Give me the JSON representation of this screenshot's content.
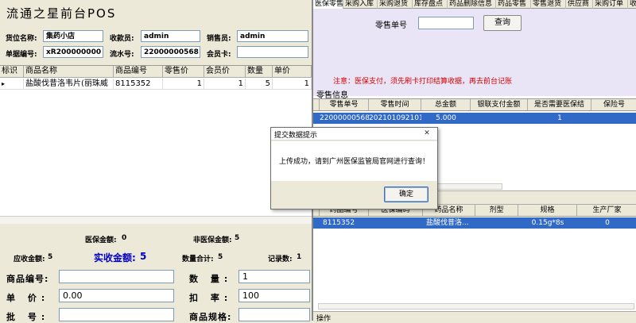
{
  "left": {
    "title": "流通之星前台POS",
    "fields": {
      "unit_label": "货位名称:",
      "unit_value": "集药小店",
      "cashier_label": "收款员:",
      "cashier_value": "admin",
      "sales_label": "销售员:",
      "sales_value": "admin",
      "doc_label": "单据编号:",
      "doc_value": "xR200000000",
      "serial_label": "流水号:",
      "serial_value": "22000000568",
      "member_label": "会员卡:",
      "member_value": ""
    },
    "grid": {
      "headers": [
        "标识",
        "商品名称",
        "商品编号",
        "零售价",
        "会员价",
        "数量",
        "单价"
      ],
      "row": {
        "marker": "▸",
        "name": "盐酸伐昔洛韦片(丽珠威",
        "code": "8115352",
        "retail": "1",
        "member": "1",
        "qty": "5",
        "unit": "1"
      }
    },
    "summary": {
      "med_label": "医保金额:",
      "med_value": "0",
      "nonmed_label": "非医保金额:",
      "nonmed_value": "5",
      "receivable_label": "应收金额:",
      "receivable_value": "5",
      "actual_label": "实收金额:",
      "actual_value": "5",
      "qty_total_label": "数量合计:",
      "qty_total_value": "5",
      "records_label": "记录数:",
      "records_value": "1"
    },
    "form": {
      "code_label": "商品编号:",
      "code_value": "",
      "qty_label": "数 量:",
      "qty_value": "1",
      "price_label": "单 价:",
      "price_value": "0.00",
      "discount_label": "扣 率:",
      "discount_value": "100",
      "batch_label": "批 号:",
      "batch_value": "",
      "spec_label": "商品规格:",
      "spec_value": ""
    }
  },
  "right": {
    "tabs": [
      "医保零售",
      "采购入库",
      "采购退货",
      "库存盘点",
      "药品删除信息",
      "药品零售",
      "零售退货",
      "供应商",
      "采购订单",
      "收"
    ],
    "search": {
      "label": "零售单号",
      "value": "",
      "button": "查询"
    },
    "notice": "注意：医保支付，须先刷卡打印结算收据，再去前台记账",
    "retail_section_label": "零售信息",
    "retail_grid": {
      "headers": [
        "零售单号",
        "零售时间",
        "总金额",
        "银联支付金额",
        "是否需要医保结",
        "保险号"
      ],
      "row": [
        "22000000568",
        "20210109210109",
        "5.000",
        "",
        "1",
        ""
      ]
    },
    "detail_grid": {
      "headers": [
        "药品编号",
        "医保编码",
        "药品名称",
        "剂型",
        "规格",
        "生产厂家"
      ],
      "row": [
        "8115352",
        "",
        "盐酸伐昔洛...",
        "",
        "0.15g*8s",
        "0"
      ]
    },
    "bottom_label": "操作"
  },
  "dialog": {
    "title": "提交数据提示",
    "message": "上传成功，请到广州医保监管局官网进行查询！",
    "ok_button": "确定",
    "close": "✕"
  },
  "colors": {
    "selected_row": "#3169c6",
    "notice_red": "#d40000",
    "actual_blue": "#0000c8"
  }
}
